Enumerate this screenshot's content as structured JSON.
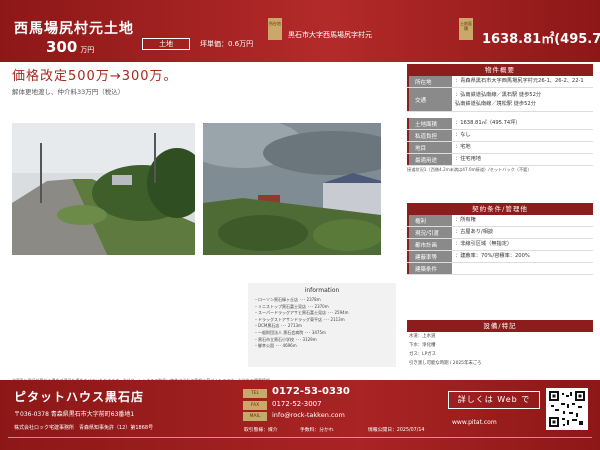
{
  "header": {
    "title": "西馬場尻村元土地",
    "price": "300",
    "price_unit": "万円",
    "category_badge": "土地",
    "tsubo_price": "坪単価：0.6万円",
    "address_tag": "所在地",
    "address": "黒石市大字西馬場尻字村元",
    "area_tag": "土地面積",
    "land_area": "1638.81㎡(495.74坪)"
  },
  "main": {
    "headline": "価格改定500万→300万。",
    "subnote": "解体更地渡し、仲介料33万円（税込）"
  },
  "information": {
    "title": "information",
    "items": [
      "ローソン黒石緑ヶ丘店 ･･･ 2378m",
      "ミニストップ黒石富士見店 ･･･ 2370m",
      "スーパードラッグアサヒ黒石富士見店 ･･･ 2594m",
      "ドラッグストアサンドラッグ東平店 ･･･ 2113m",
      "DCM黒石店 ･･･ 2713m",
      "一般財団法人 黒石会病院 ･･･ 3475m",
      "黒石市立黒石小学校 ･･･ 3129m",
      "御幸公園 ･･･ 4696m"
    ]
  },
  "footnote": "※図面と現況が異なる場合は現況を優先させていただきます。※ピタットハウスの取扱い物件は当社の情報に基づくものです。当広告の掲載情報",
  "property": {
    "section_title": "物件概要",
    "rows": [
      {
        "label": "所在地",
        "values": [
          "青森県黒石市大字西馬場尻字村元26-1、26-2、22-1"
        ]
      },
      {
        "label": "交通",
        "values": [
          "弘南鉄道弘南線／黒石駅 徒歩52分",
          "弘南鉄道弘南線／境松駅 徒歩52分"
        ]
      },
      {
        "label": "土地面積",
        "values": [
          "1638.81㎡（495.74坪）"
        ]
      },
      {
        "label": "私道負担",
        "values": [
          "なし"
        ]
      },
      {
        "label": "地目",
        "values": [
          "宅地"
        ]
      },
      {
        "label": "最適用途",
        "values": [
          "住宅用地"
        ]
      }
    ],
    "note": "接道状況1（西側4.2m未満は47.0m接道）/セットバック（不要）"
  },
  "contract": {
    "section_title": "契約条件/管理他",
    "rows": [
      {
        "label": "権利",
        "values": [
          "所有権"
        ]
      },
      {
        "label": "現況/引渡",
        "values": [
          "古屋あり/相談"
        ]
      },
      {
        "label": "都市計画",
        "values": [
          "非線引区域（無指定）"
        ]
      },
      {
        "label": "建蔽率等",
        "values": [
          "建蔽率：70%/容積率：200%"
        ]
      },
      {
        "label": "建築条件",
        "values": [
          ""
        ]
      }
    ]
  },
  "facilities": {
    "section_title": "設備/特記",
    "items": [
      "水道：上水道",
      "下水：浄化槽",
      "ガス：LPガス",
      "引き渡し可能な時期 / 2025年末ごろ"
    ]
  },
  "footer": {
    "company": "ピタットハウス黒石店",
    "address": "〒036-0378 青森県黒石市大字前町63番地1",
    "license": "株式会社ロック宅建事務所　青森県知事免許（12）第1868号",
    "tel_tag": "TEL",
    "tel": "0172-53-0330",
    "fax_tag": "FAX",
    "fax": "0172-52-3007",
    "mail_tag": "MAIL",
    "mail": "info@rock-takken.com",
    "details_button": "詳しくは Web で",
    "url": "www.pitat.com",
    "bottom": [
      {
        "key": "取引態様：",
        "value": "媒介"
      },
      {
        "key": "手数料：",
        "value": "分かれ"
      },
      {
        "key": "情報公開日：",
        "value": "2025/07/14"
      }
    ]
  },
  "colors": {
    "brand_red": "#8d1717",
    "gold": "#c9a86a",
    "headline": "#a8281f"
  }
}
